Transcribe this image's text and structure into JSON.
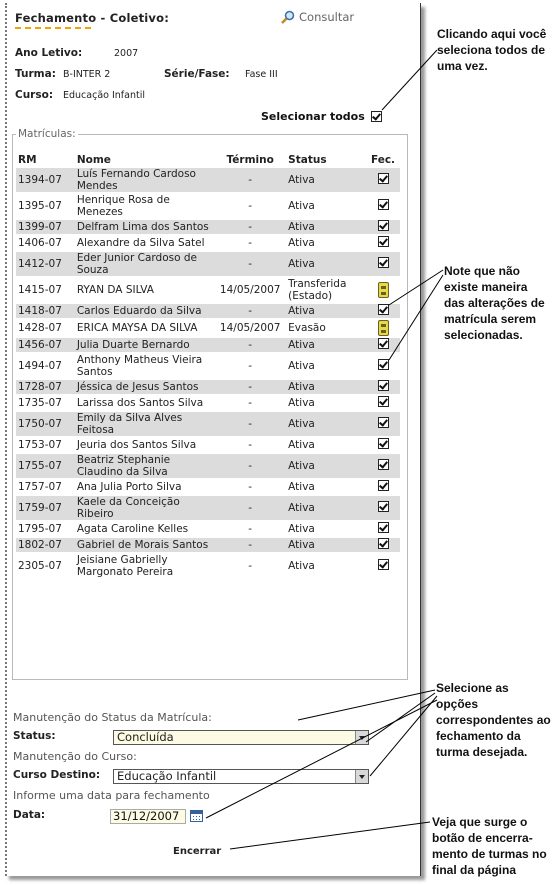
{
  "header": {
    "title": "Fechamento - Coletivo:",
    "consultar": "Consultar"
  },
  "info": {
    "ano_label": "Ano Letivo:",
    "ano_value": "2007",
    "turma_label": "Turma:",
    "turma_value": "B-INTER 2",
    "serie_label": "Série/Fase:",
    "serie_value": "Fase III",
    "curso_label": "Curso:",
    "curso_value": "Educação Infantil"
  },
  "select_all_label": "Selecionar todos",
  "matriculas": {
    "legend": "Matrículas:",
    "columns": [
      "RM",
      "Nome",
      "Término",
      "Status",
      "Fec."
    ],
    "rows": [
      {
        "rm": "1394-07",
        "nome": "Luís Fernando Cardoso Mendes",
        "termino": "-",
        "status": "Ativa",
        "fec": "check"
      },
      {
        "rm": "1395-07",
        "nome": "Henrique Rosa de Menezes",
        "termino": "-",
        "status": "Ativa",
        "fec": "check"
      },
      {
        "rm": "1399-07",
        "nome": "Delfram Lima dos Santos",
        "termino": "-",
        "status": "Ativa",
        "fec": "check"
      },
      {
        "rm": "1406-07",
        "nome": "Alexandre da Silva Satel",
        "termino": "-",
        "status": "Ativa",
        "fec": "check"
      },
      {
        "rm": "1412-07",
        "nome": "Eder Junior Cardoso de Souza",
        "termino": "-",
        "status": "Ativa",
        "fec": "check"
      },
      {
        "rm": "1415-07",
        "nome": "RYAN DA SILVA",
        "termino": "14/05/2007",
        "status": "Transferida (Estado)",
        "fec": "file"
      },
      {
        "rm": "1418-07",
        "nome": "Carlos Eduardo da Silva",
        "termino": "-",
        "status": "Ativa",
        "fec": "check"
      },
      {
        "rm": "1428-07",
        "nome": "ERICA MAYSA DA SILVA",
        "termino": "14/05/2007",
        "status": "Evasão",
        "fec": "file"
      },
      {
        "rm": "1456-07",
        "nome": "Julia Duarte Bernardo",
        "termino": "-",
        "status": "Ativa",
        "fec": "check"
      },
      {
        "rm": "1494-07",
        "nome": "Anthony Matheus Vieira Santos",
        "termino": "-",
        "status": "Ativa",
        "fec": "check"
      },
      {
        "rm": "1728-07",
        "nome": "Jéssica de Jesus Santos",
        "termino": "-",
        "status": "Ativa",
        "fec": "check"
      },
      {
        "rm": "1735-07",
        "nome": "Larissa dos Santos Silva",
        "termino": "-",
        "status": "Ativa",
        "fec": "check"
      },
      {
        "rm": "1750-07",
        "nome": "Emily da Silva Alves Feitosa",
        "termino": "-",
        "status": "Ativa",
        "fec": "check"
      },
      {
        "rm": "1753-07",
        "nome": "Jeuria dos Santos Silva",
        "termino": "-",
        "status": "Ativa",
        "fec": "check"
      },
      {
        "rm": "1755-07",
        "nome": "Beatriz Stephanie Claudino da Silva",
        "termino": "-",
        "status": "Ativa",
        "fec": "check"
      },
      {
        "rm": "1757-07",
        "nome": "Ana Julia Porto Silva",
        "termino": "-",
        "status": "Ativa",
        "fec": "check"
      },
      {
        "rm": "1759-07",
        "nome": "Kaele da Conceição Ribeiro",
        "termino": "-",
        "status": "Ativa",
        "fec": "check"
      },
      {
        "rm": "1795-07",
        "nome": "Agata Caroline Kelles",
        "termino": "-",
        "status": "Ativa",
        "fec": "check"
      },
      {
        "rm": "1802-07",
        "nome": "Gabriel de Morais Santos",
        "termino": "-",
        "status": "Ativa",
        "fec": "check"
      },
      {
        "rm": "2305-07",
        "nome": "Jeisiane Gabrielly Margonato Pereira",
        "termino": "-",
        "status": "Ativa",
        "fec": "check"
      }
    ]
  },
  "form": {
    "status_section": "Manutenção do Status da Matrícula:",
    "status_label": "Status:",
    "status_value": "Concluída",
    "curso_section": "Manutenção do Curso:",
    "curso_destino_label": "Curso Destino:",
    "curso_destino_value": "Educação Infantil",
    "data_section": "Informe uma data para fechamento",
    "data_label": "Data:",
    "data_value": "31/12/2007",
    "encerrar": "Encerrar"
  },
  "annotations": {
    "select_all": "Clicando aqui você seleciona todos de uma vez.",
    "no_select": "Note que não existe maneira das alterações de matrícula serem selecionadas.",
    "options": "Selecione as opções correspondentes ao fechamento da turma desejada.",
    "button": "Veja que surge o botão de encerra-mento de turmas no final da página"
  },
  "colors": {
    "accent": "#f0a400",
    "row_alt": "#dcdcdc",
    "field_bg": "#fdfbe3"
  }
}
